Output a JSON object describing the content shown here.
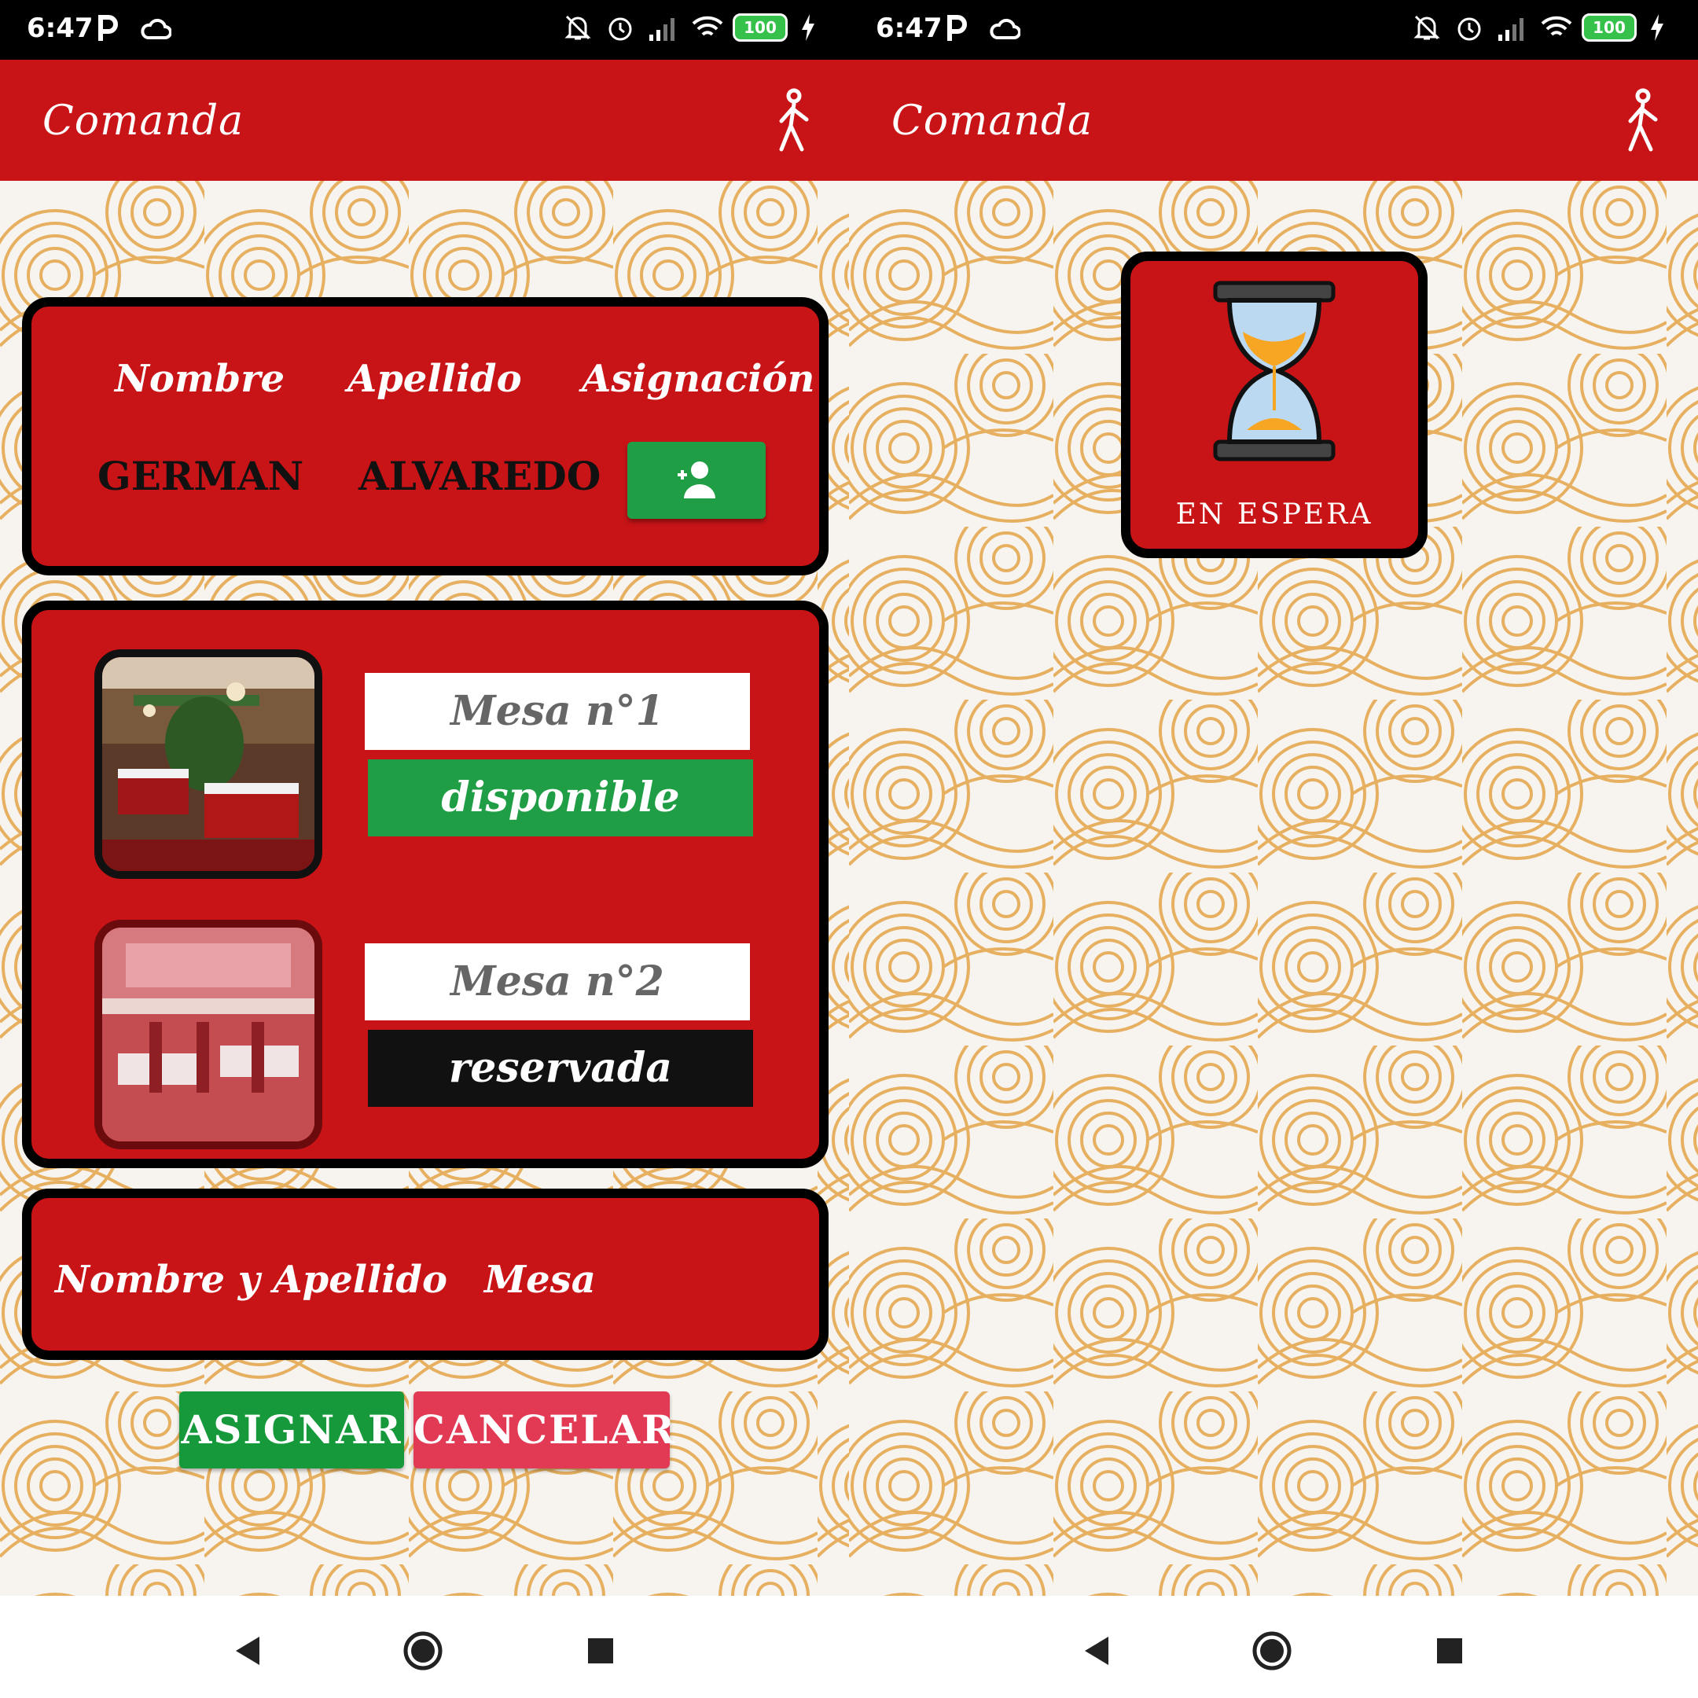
{
  "status_bar": {
    "time": "6:47",
    "battery": "100"
  },
  "app_bar": {
    "title": "Comanda"
  },
  "person": {
    "headers": {
      "nombre": "Nombre",
      "apellido": "Apellido",
      "asignacion": "Asignación"
    },
    "nombre": "GERMAN",
    "apellido": "ALVAREDO"
  },
  "tables": [
    {
      "label": "Mesa n°1",
      "status": "disponible"
    },
    {
      "label": "Mesa n°2",
      "status": "reservada"
    }
  ],
  "summary": {
    "nombre_apellido": "Nombre y Apellido",
    "mesa": "Mesa"
  },
  "buttons": {
    "asignar": "ASIGNAR",
    "cancelar": "CANCELAR"
  },
  "waiting": {
    "label": "EN ESPERA"
  },
  "colors": {
    "primary_red": "#c81417",
    "green": "#1f9e45",
    "pink": "#e23a55",
    "wave_orange": "#e8b867"
  }
}
